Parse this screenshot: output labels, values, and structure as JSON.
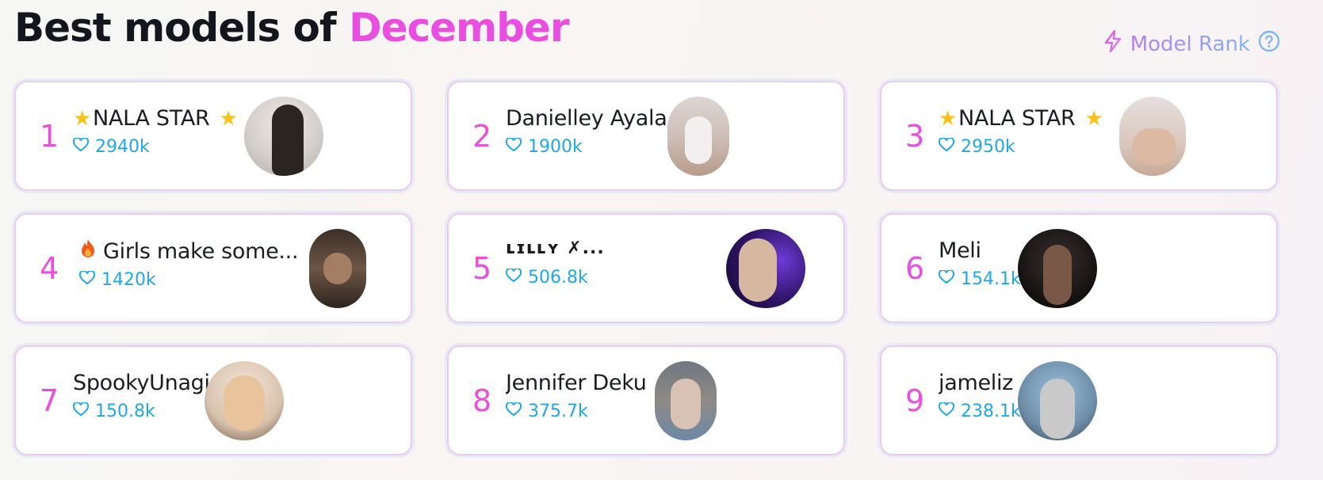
{
  "header": {
    "title_prefix": "Best models of",
    "title_month": "December"
  },
  "rank_link": {
    "label": "Model Rank",
    "icon": "lightning-icon",
    "help_icon": "help-circle-icon"
  },
  "colors": {
    "accent": "#e94ee0",
    "likes": "#20a7e6",
    "card_border": "#eccaf1"
  },
  "models": [
    {
      "rank": "1",
      "name": "NALA STAR",
      "prefix_icon": "star-icon",
      "suffix_icon": "star-icon",
      "likes": "2940k"
    },
    {
      "rank": "2",
      "name": "Danielley Ayala",
      "likes": "1900k"
    },
    {
      "rank": "3",
      "name": "NALA STAR",
      "prefix_icon": "star-icon",
      "suffix_icon": "star-icon",
      "likes": "2950k"
    },
    {
      "rank": "4",
      "name": "Girls make some...",
      "prefix_icon": "fire-icon",
      "likes": "1420k"
    },
    {
      "rank": "5",
      "name": "ʟɪʟʟʏ ✗...",
      "likes": "506.8k"
    },
    {
      "rank": "6",
      "name": "Meli",
      "likes": "154.1k"
    },
    {
      "rank": "7",
      "name": "SpookyUnagi",
      "likes": "150.8k"
    },
    {
      "rank": "8",
      "name": "Jennifer Deku",
      "likes": "375.7k"
    },
    {
      "rank": "9",
      "name": "jameliz",
      "likes": "238.1k"
    }
  ]
}
